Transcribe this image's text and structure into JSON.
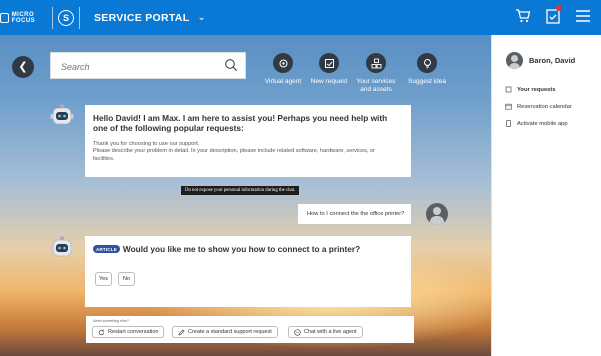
{
  "header": {
    "logo_text": "MICRO FOCUS",
    "portal_title": "SERVICE PORTAL",
    "chevron": "⌄",
    "icons": [
      "cart-icon",
      "notifications-icon",
      "menu-icon"
    ]
  },
  "search": {
    "placeholder": "Search"
  },
  "quick_actions": [
    {
      "label": "Virtual agent",
      "icon": "virtual-agent-icon"
    },
    {
      "label": "New request",
      "icon": "new-request-icon"
    },
    {
      "label": "Your services and assets",
      "icon": "services-icon"
    },
    {
      "label": "Suggest idea",
      "icon": "idea-icon"
    }
  ],
  "sidebar": {
    "user_name": "Baron, David",
    "items": [
      {
        "label": "Your requests",
        "icon": "requests-icon"
      },
      {
        "label": "Reservation calendar",
        "icon": "calendar-icon"
      },
      {
        "label": "Activate mobile app",
        "icon": "mobile-icon"
      }
    ]
  },
  "chat": {
    "greeting_title": "Hello David! I am Max. I am here to assist you! Perhaps you need help with one of the following popular requests:",
    "greeting_body": "Thank you for choosing to use our support.\nPlease describe your problem in detail. In your description, please include related software, hardware, services, or facilities.",
    "privacy_notice": "Do not expose your personal information during the chat.",
    "user_message": "How to I connect the the office printer?",
    "article_tag": "ARTICLE",
    "article_question": "Would you like me to show you how to connect to a printer?",
    "yes_label": "Yes",
    "no_label": "No"
  },
  "footer": {
    "prompt": "Need something else?",
    "buttons": [
      {
        "label": "Restart conversation",
        "icon": "restart-icon"
      },
      {
        "label": "Create a standard support request",
        "icon": "edit-icon"
      },
      {
        "label": "Chat with a live agent",
        "icon": "chat-icon"
      }
    ]
  },
  "colors": {
    "header_blue": "#0a79d6",
    "dark_icon": "#2f3a44",
    "article_tag": "#3450a3",
    "badge_red": "#e8322f"
  }
}
